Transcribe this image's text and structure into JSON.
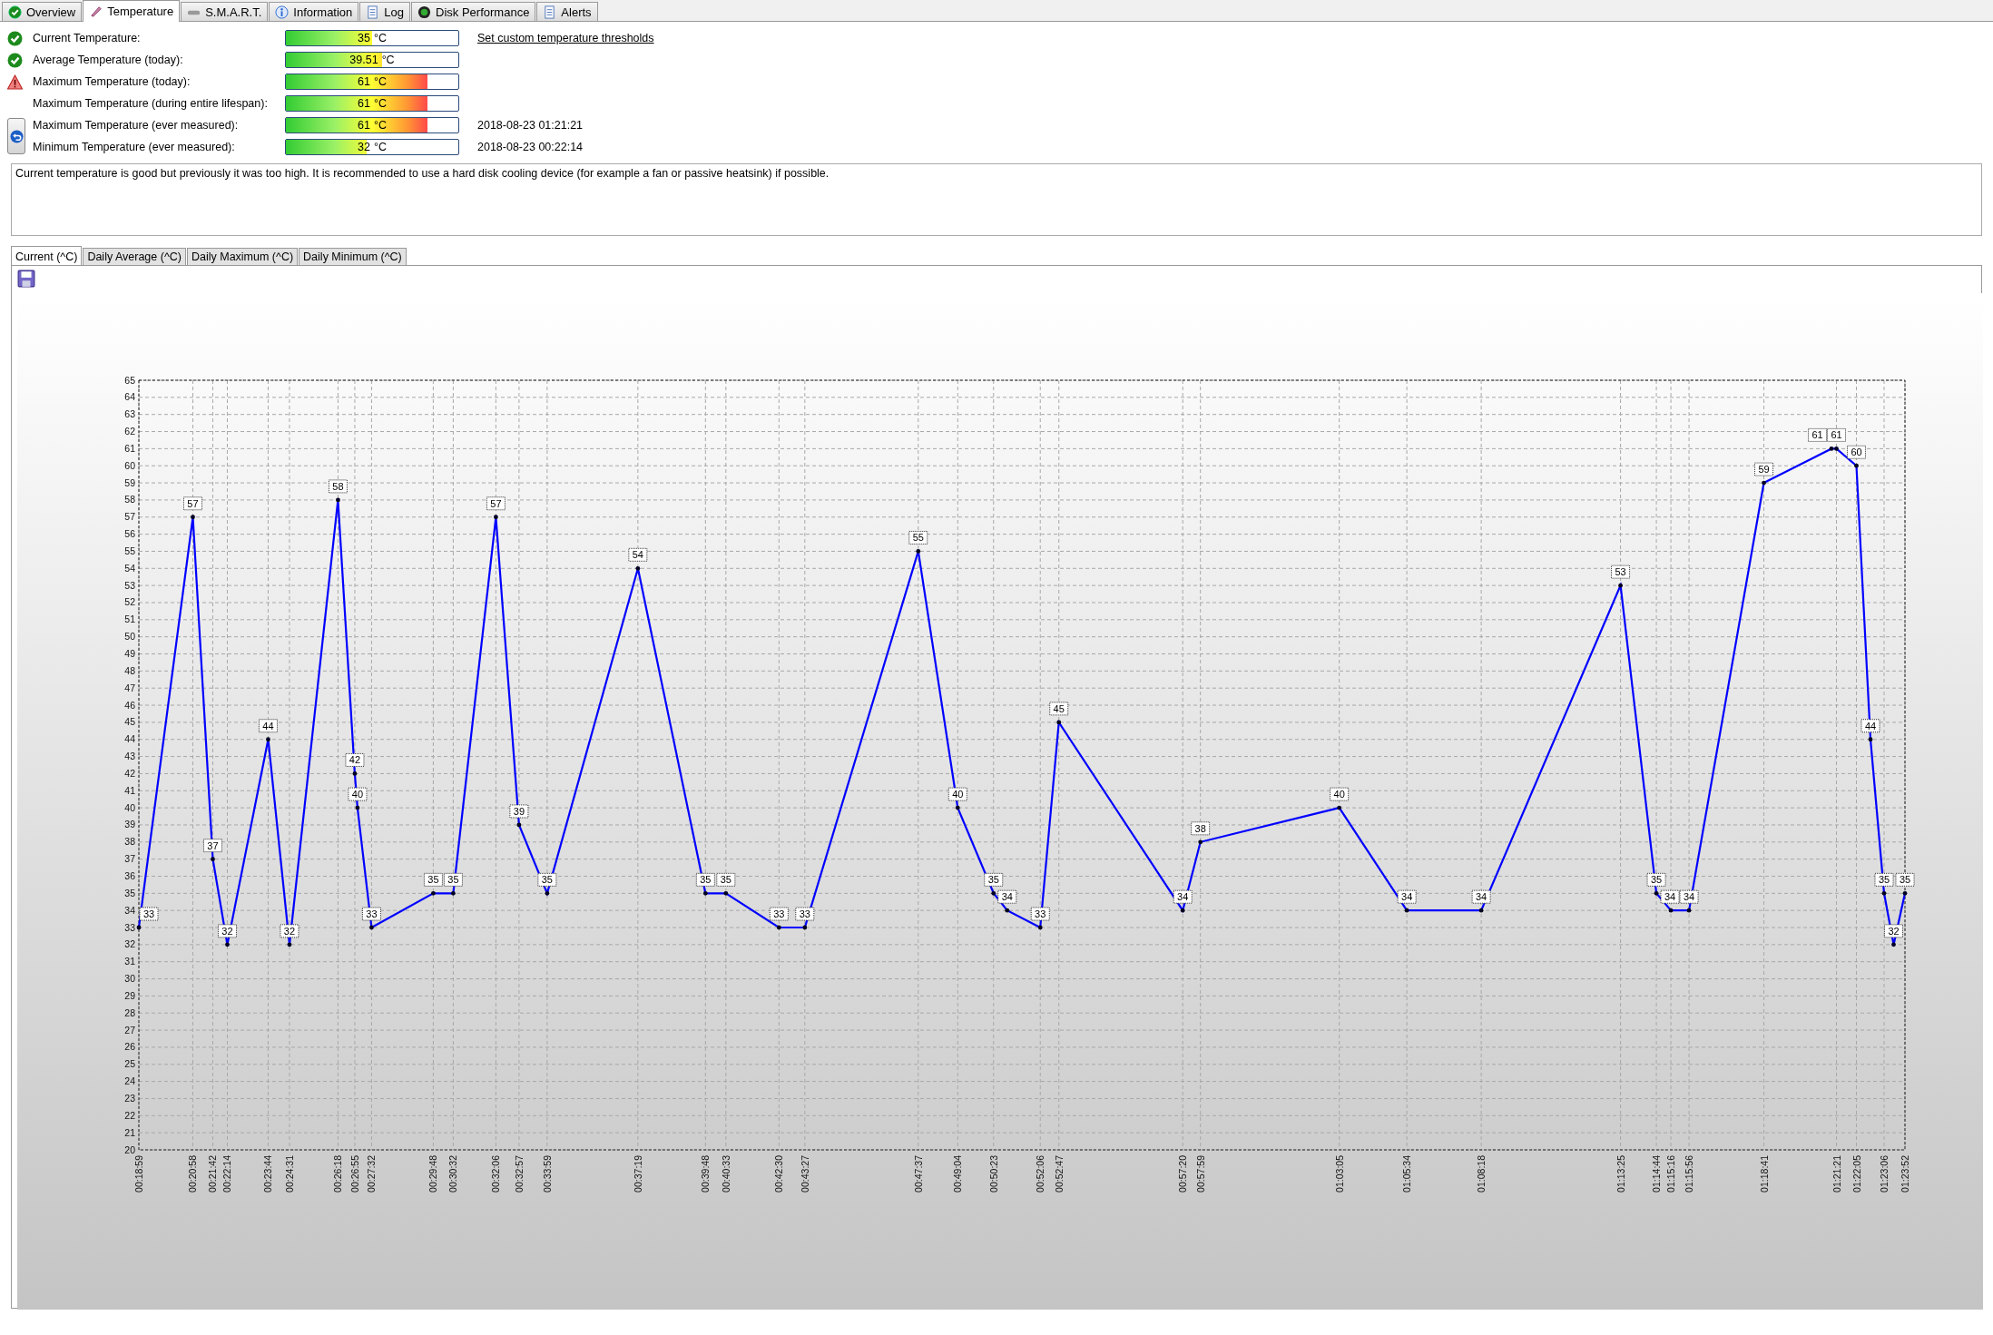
{
  "tabs": [
    {
      "label": "Overview",
      "selected": false
    },
    {
      "label": "Temperature",
      "selected": true
    },
    {
      "label": "S.M.A.R.T.",
      "selected": false
    },
    {
      "label": "Information",
      "selected": false
    },
    {
      "label": "Log",
      "selected": false
    },
    {
      "label": "Disk Performance",
      "selected": false
    },
    {
      "label": "Alerts",
      "selected": false
    }
  ],
  "readings": [
    {
      "kind": "ok",
      "label": "Current Temperature:",
      "value": "35",
      "unit": "°C",
      "level": 0.5,
      "link": "Set custom temperature thresholds"
    },
    {
      "kind": "ok",
      "label": "Average Temperature (today):",
      "value": "39.51",
      "unit": "°C",
      "level": 0.56
    },
    {
      "kind": "warning",
      "label": "Maximum Temperature (today):",
      "value": "61",
      "unit": "°C",
      "level": 0.82
    },
    {
      "kind": "plain",
      "label": "Maximum Temperature (during entire lifespan):",
      "value": "61",
      "unit": "°C",
      "level": 0.82
    },
    {
      "kind": "plain",
      "label": "Maximum Temperature (ever measured):",
      "value": "61",
      "unit": "°C",
      "level": 0.82,
      "timestamp": "2018-08-23 01:21:21"
    },
    {
      "kind": "plain",
      "label": "Minimum Temperature (ever measured):",
      "value": "32",
      "unit": "°C",
      "level": 0.47,
      "timestamp": "2018-08-23 00:22:14"
    }
  ],
  "message": "Current temperature is good but previously it was too high. It is recommended to use a hard disk cooling device (for example a fan or passive heatsink) if possible.",
  "chart_tabs": [
    {
      "label": "Current (^C)",
      "selected": true
    },
    {
      "label": "Daily Average (^C)",
      "selected": false
    },
    {
      "label": "Daily Maximum (^C)",
      "selected": false
    },
    {
      "label": "Daily Minimum (^C)",
      "selected": false
    }
  ],
  "chart_data": {
    "type": "line",
    "grid": true,
    "data_labels": true,
    "xlim": [
      1139,
      5032
    ],
    "ylim": [
      20,
      65
    ],
    "x": [
      1139,
      1258,
      1302,
      1334,
      1424,
      1471,
      1578,
      1615,
      1621,
      1652,
      1788,
      1832,
      1926,
      1977,
      2039,
      2239,
      2388,
      2433,
      2550,
      2607,
      2857,
      2944,
      3023,
      3053,
      3126,
      3167,
      3440,
      3479,
      3785,
      3934,
      4098,
      4405,
      4484,
      4516,
      4556,
      4721,
      4870,
      4881,
      4925,
      4956,
      4986,
      5007,
      5032
    ],
    "series": [
      {
        "color": "#0000ff",
        "values": [
          33,
          57,
          37,
          32,
          44,
          32,
          58,
          42,
          40,
          33,
          35,
          35,
          57,
          39,
          35,
          54,
          35,
          35,
          33,
          33,
          55,
          40,
          35,
          34,
          33,
          45,
          34,
          38,
          40,
          34,
          34,
          53,
          35,
          34,
          34,
          59,
          61,
          61,
          60,
          44,
          35,
          32,
          35
        ]
      }
    ],
    "yticks": [
      20,
      21,
      22,
      23,
      24,
      25,
      26,
      27,
      28,
      29,
      30,
      31,
      32,
      33,
      34,
      35,
      36,
      37,
      38,
      39,
      40,
      41,
      42,
      43,
      44,
      45,
      46,
      47,
      48,
      49,
      50,
      51,
      52,
      53,
      54,
      55,
      56,
      57,
      58,
      59,
      60,
      61,
      62,
      63,
      64,
      65
    ],
    "xticks": [
      {
        "value": 1139,
        "label": "00:18:59"
      },
      {
        "value": 1258,
        "label": "00:20:58"
      },
      {
        "value": 1302,
        "label": "00:21:42"
      },
      {
        "value": 1334,
        "label": "00:22:14"
      },
      {
        "value": 1424,
        "label": "00:23:44"
      },
      {
        "value": 1471,
        "label": "00:24:31"
      },
      {
        "value": 1578,
        "label": "00:26:18"
      },
      {
        "value": 1615,
        "label": "00:26:55"
      },
      {
        "value": 1652,
        "label": "00:27:32"
      },
      {
        "value": 1788,
        "label": "00:29:48"
      },
      {
        "value": 1832,
        "label": "00:30:32"
      },
      {
        "value": 1926,
        "label": "00:32:06"
      },
      {
        "value": 1977,
        "label": "00:32:57"
      },
      {
        "value": 2039,
        "label": "00:33:59"
      },
      {
        "value": 2239,
        "label": "00:37:19"
      },
      {
        "value": 2388,
        "label": "00:39:48"
      },
      {
        "value": 2433,
        "label": "00:40:33"
      },
      {
        "value": 2550,
        "label": "00:42:30"
      },
      {
        "value": 2607,
        "label": "00:43:27"
      },
      {
        "value": 2857,
        "label": "00:47:37"
      },
      {
        "value": 2944,
        "label": "00:49:04"
      },
      {
        "value": 3023,
        "label": "00:50:23"
      },
      {
        "value": 3126,
        "label": "00:52:06"
      },
      {
        "value": 3167,
        "label": "00:52:47"
      },
      {
        "value": 3440,
        "label": "00:57:20"
      },
      {
        "value": 3479,
        "label": "00:57:59"
      },
      {
        "value": 3785,
        "label": "01:03:05"
      },
      {
        "value": 3934,
        "label": "01:05:34"
      },
      {
        "value": 4098,
        "label": "01:08:18"
      },
      {
        "value": 4405,
        "label": "01:13:25"
      },
      {
        "value": 4484,
        "label": "01:14:44"
      },
      {
        "value": 4516,
        "label": "01:15:16"
      },
      {
        "value": 4556,
        "label": "01:15:56"
      },
      {
        "value": 4721,
        "label": "01:18:41"
      },
      {
        "value": 4881,
        "label": "01:21:21"
      },
      {
        "value": 4925,
        "label": "01:22:05"
      },
      {
        "value": 4986,
        "label": "01:23:06"
      },
      {
        "value": 5032,
        "label": "01:23:52"
      }
    ]
  }
}
